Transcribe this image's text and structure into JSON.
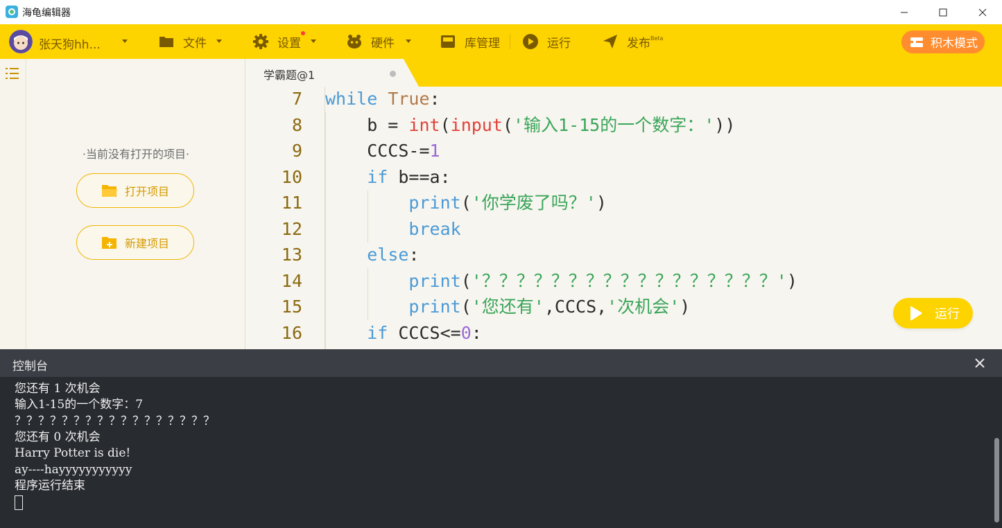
{
  "window": {
    "title": "海龟编辑器"
  },
  "toolbar": {
    "user_name": "张天狗hh...",
    "file": "文件",
    "settings": "设置",
    "hardware": "硬件",
    "library": "库管理",
    "run": "运行",
    "publish": "发布",
    "publish_badge": "Beta",
    "block_mode": "积木模式"
  },
  "project_panel": {
    "empty_message": "·当前没有打开的项目·",
    "open_project": "打开项目",
    "new_project": "新建项目"
  },
  "editor": {
    "tab_name": "学霸题@1",
    "run_button": "运行",
    "lines": [
      {
        "n": "7",
        "tokens": [
          [
            "kw",
            "while"
          ],
          [
            "pl",
            " "
          ],
          [
            "bool",
            "True"
          ],
          [
            "pl",
            ":"
          ]
        ]
      },
      {
        "n": "8",
        "tokens": [
          [
            "pl",
            "    b = "
          ],
          [
            "fn",
            "int"
          ],
          [
            "pl",
            "("
          ],
          [
            "fn",
            "input"
          ],
          [
            "pl",
            "("
          ],
          [
            "str",
            "'输入1-15的一个数字：'"
          ],
          [
            "pl",
            "))"
          ]
        ]
      },
      {
        "n": "9",
        "tokens": [
          [
            "pl",
            "    CCCS-="
          ],
          [
            "num",
            "1"
          ]
        ]
      },
      {
        "n": "10",
        "tokens": [
          [
            "pl",
            "    "
          ],
          [
            "kw",
            "if"
          ],
          [
            "pl",
            " b==a:"
          ]
        ]
      },
      {
        "n": "11",
        "tokens": [
          [
            "pl",
            "        "
          ],
          [
            "kw",
            "print"
          ],
          [
            "pl",
            "("
          ],
          [
            "str",
            "'你学废了吗？'"
          ],
          [
            "pl",
            ")"
          ]
        ]
      },
      {
        "n": "12",
        "tokens": [
          [
            "pl",
            "        "
          ],
          [
            "kw",
            "break"
          ]
        ]
      },
      {
        "n": "13",
        "tokens": [
          [
            "pl",
            "    "
          ],
          [
            "kw",
            "else"
          ],
          [
            "pl",
            ":"
          ]
        ]
      },
      {
        "n": "14",
        "tokens": [
          [
            "pl",
            "        "
          ],
          [
            "kw",
            "print"
          ],
          [
            "pl",
            "("
          ],
          [
            "str",
            "'？？？？？？？？？？？？？？？？？'"
          ],
          [
            "pl",
            ")"
          ]
        ]
      },
      {
        "n": "15",
        "tokens": [
          [
            "pl",
            "        "
          ],
          [
            "kw",
            "print"
          ],
          [
            "pl",
            "("
          ],
          [
            "str",
            "'您还有'"
          ],
          [
            "pl",
            ",CCCS,"
          ],
          [
            "str",
            "'次机会'"
          ],
          [
            "pl",
            ")"
          ]
        ]
      },
      {
        "n": "16",
        "tokens": [
          [
            "pl",
            "    "
          ],
          [
            "kw",
            "if"
          ],
          [
            "pl",
            " CCCS<="
          ],
          [
            "num",
            "0"
          ],
          [
            "pl",
            ":"
          ]
        ]
      }
    ]
  },
  "console": {
    "title": "控制台",
    "lines": [
      "您还有 1 次机会",
      "输入1-15的一个数字：7",
      "？？？？？？？？？？？？？？？？？",
      "您还有 0 次机会",
      "Harry Potter is die!",
      "ay----hayyyyyyyyyyy",
      "程序运行结束"
    ]
  },
  "colors": {
    "accent": "#fdd300",
    "block_mode": "#ff8c2e",
    "console_bg": "#282b30"
  }
}
